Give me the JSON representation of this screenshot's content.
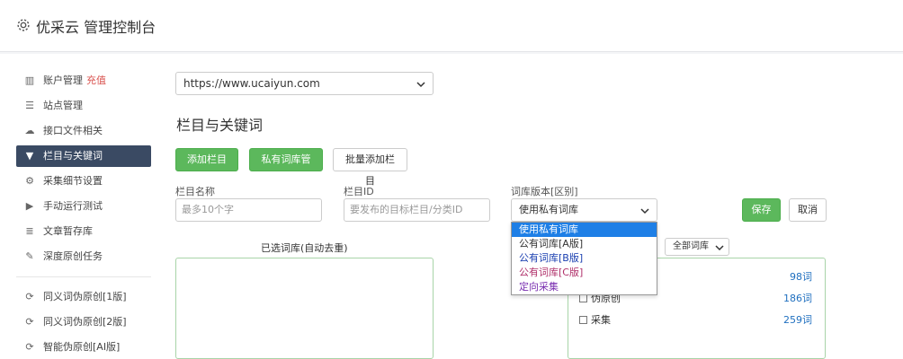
{
  "header": {
    "title": "优采云 管理控制台",
    "icon": "gear-icon"
  },
  "sidebar": {
    "group1": [
      {
        "label": "账户管理",
        "extra": "充值",
        "icon": "bar-chart-icon",
        "glyph": "▥"
      },
      {
        "label": "站点管理",
        "icon": "server-icon",
        "glyph": "☰"
      },
      {
        "label": "接口文件相关",
        "icon": "cloud-upload-icon",
        "glyph": "☁"
      },
      {
        "label": "栏目与关键词",
        "icon": "filter-icon",
        "glyph": "▼",
        "active": true
      },
      {
        "label": "采集细节设置",
        "icon": "cogs-icon",
        "glyph": "⚙"
      },
      {
        "label": "手动运行测试",
        "icon": "play-circle-icon",
        "glyph": "▶"
      },
      {
        "label": "文章暂存库",
        "icon": "database-icon",
        "glyph": "≣"
      },
      {
        "label": "深度原创任务",
        "icon": "edit-icon",
        "glyph": "✎"
      }
    ],
    "group2": [
      {
        "label": "同义词伪原创[1版]",
        "icon": "refresh-icon",
        "glyph": "⟳"
      },
      {
        "label": "同义词伪原创[2版]",
        "icon": "refresh-icon",
        "glyph": "⟳"
      },
      {
        "label": "智能伪原创[AI版]",
        "icon": "refresh-icon",
        "glyph": "⟳"
      }
    ]
  },
  "site_select": {
    "value": "https://www.ucaiyun.com"
  },
  "page_title": "栏目与关键词",
  "toolbar": {
    "add_column": "添加栏目 +",
    "private_lib": "私有词库管理",
    "batch_add": "批量添加栏目"
  },
  "form": {
    "name_label": "栏目名称",
    "name_placeholder": "最多10个字",
    "id_label": "栏目ID",
    "id_placeholder": "要发布的目标栏目/分类ID",
    "version_label": "词库版本[区别]",
    "version_value": "使用私有词库",
    "save": "保存",
    "cancel": "取消"
  },
  "version_options": [
    {
      "label": "使用私有词库",
      "color": "#ffffff",
      "selected": true
    },
    {
      "label": "公有词库[A版]",
      "color": "#333333"
    },
    {
      "label": "公有词库[B版]",
      "color": "#1a3fb0"
    },
    {
      "label": "公有词库[C版]",
      "color": "#b0306a"
    },
    {
      "label": "定向采集",
      "color": "#7a2fb0"
    }
  ],
  "selected_libs": {
    "title": "已选词库(自动去重)"
  },
  "libs": {
    "filter_value": "全部词库",
    "rows": [
      {
        "name": "",
        "count": "98词"
      },
      {
        "name": "伪原创",
        "count": "186词"
      },
      {
        "name": "采集",
        "count": "259词"
      }
    ]
  },
  "colors": {
    "green": "#5cb85c",
    "sidebar_active": "#3a4a63",
    "link": "#1f6fbf",
    "warn": "#d9534f"
  }
}
